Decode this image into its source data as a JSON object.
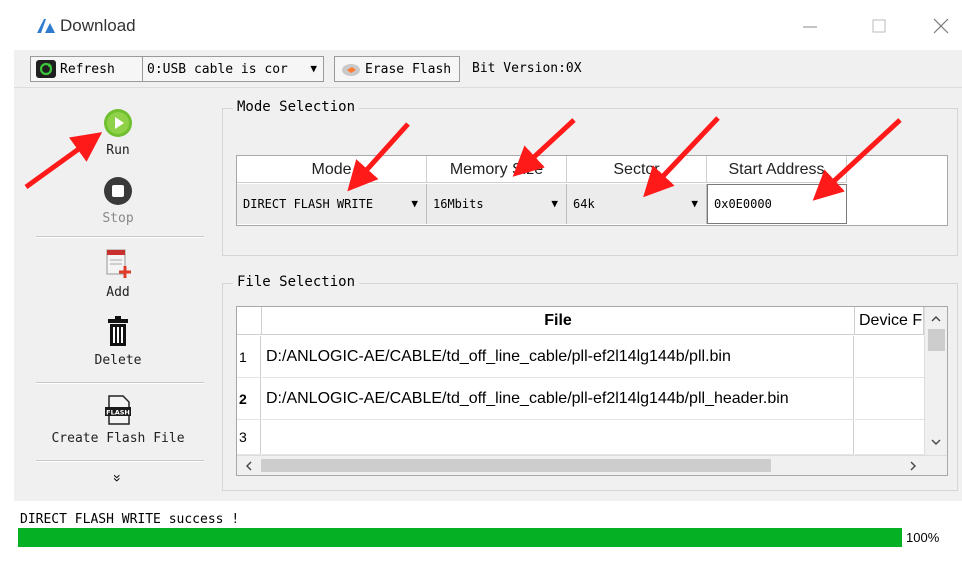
{
  "window": {
    "title": "Download",
    "minimize_glyph": "—",
    "maximize_glyph": "☐",
    "close_glyph": "✕"
  },
  "toolbar": {
    "refresh_label": "Refresh",
    "cable_select_value": "0:USB cable is cor",
    "erase_label": "Erase Flash",
    "bit_version": "Bit Version:0X"
  },
  "left_panel": {
    "run_label": "Run",
    "stop_label": "Stop",
    "add_label": "Add",
    "delete_label": "Delete",
    "create_flash_label": "Create Flash File",
    "flash_icon_text": "FLASH",
    "more_glyph": "»"
  },
  "mode_selection": {
    "title": "Mode Selection",
    "headers": [
      "Mode",
      "Memory Size",
      "Sector",
      "Start Address"
    ],
    "mode_value": "DIRECT FLASH WRITE",
    "memory_value": "16Mbits",
    "sector_value": "64k",
    "start_address_value": "0x0E0000"
  },
  "file_selection": {
    "title": "File Selection",
    "headers": [
      "File",
      "Device F"
    ],
    "rows": [
      {
        "num": "1",
        "file": "D:/ANLOGIC-AE/CABLE/td_off_line_cable/pll-ef2l14lg144b/pll.bin"
      },
      {
        "num": "2",
        "file": "D:/ANLOGIC-AE/CABLE/td_off_line_cable/pll-ef2l14lg144b/pll_header.bin"
      },
      {
        "num": "3",
        "file": ""
      }
    ]
  },
  "status": {
    "message": "DIRECT FLASH WRITE success !",
    "progress_label": "100%",
    "progress_fraction": 1.0
  },
  "colors": {
    "progress_green": "#06b025",
    "annotation_red": "#ff1a1a",
    "run_green": "#6fbf2e"
  }
}
